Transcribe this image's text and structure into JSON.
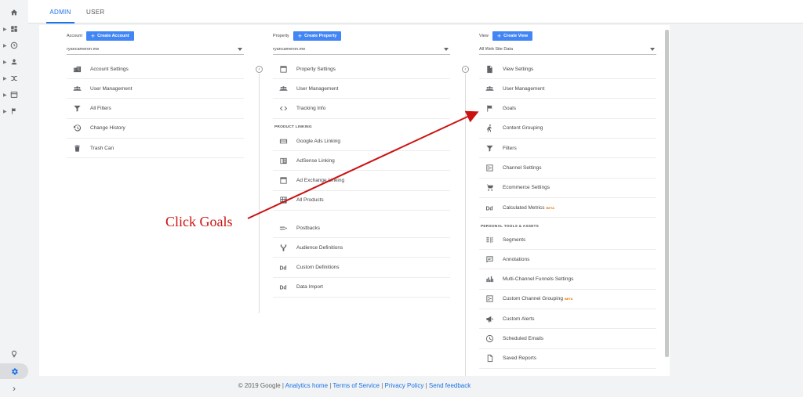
{
  "tabs": {
    "admin": "ADMIN",
    "user": "USER"
  },
  "account": {
    "label": "Account",
    "create_label": "Create Account",
    "selected": "ryancameron.me",
    "items": [
      {
        "label": "Account Settings",
        "icon": "building-icon"
      },
      {
        "label": "User Management",
        "icon": "people-icon"
      },
      {
        "label": "All Filters",
        "icon": "filter-icon"
      },
      {
        "label": "Change History",
        "icon": "history-icon"
      },
      {
        "label": "Trash Can",
        "icon": "trash-icon"
      }
    ]
  },
  "property": {
    "label": "Property",
    "create_label": "Create Property",
    "selected": "ryancameron.me",
    "items": [
      {
        "label": "Property Settings",
        "icon": "window-icon"
      },
      {
        "label": "User Management",
        "icon": "people-icon"
      },
      {
        "label": "Tracking Info",
        "icon": "code-icon"
      }
    ],
    "section_label": "PRODUCT LINKING",
    "linking_items": [
      {
        "label": "Google Ads Linking",
        "icon": "ads-icon"
      },
      {
        "label": "AdSense Linking",
        "icon": "book-icon"
      },
      {
        "label": "Ad Exchange Linking",
        "icon": "window-icon"
      },
      {
        "label": "All Products",
        "icon": "grid-icon"
      }
    ],
    "more_items": [
      {
        "label": "Postbacks",
        "icon": "postback-icon"
      },
      {
        "label": "Audience Definitions",
        "icon": "fork-icon"
      },
      {
        "label": "Custom Definitions",
        "icon": "dd-icon"
      },
      {
        "label": "Data Import",
        "icon": "dd-icon"
      }
    ]
  },
  "view": {
    "label": "View",
    "create_label": "Create View",
    "selected": "All Web Site Data",
    "items": [
      {
        "label": "View Settings",
        "icon": "document-icon",
        "beta": ""
      },
      {
        "label": "User Management",
        "icon": "people-icon",
        "beta": ""
      },
      {
        "label": "Goals",
        "icon": "flag-icon",
        "beta": ""
      },
      {
        "label": "Content Grouping",
        "icon": "walk-icon",
        "beta": ""
      },
      {
        "label": "Filters",
        "icon": "filter-icon",
        "beta": ""
      },
      {
        "label": "Channel Settings",
        "icon": "channel-icon",
        "beta": ""
      },
      {
        "label": "Ecommerce Settings",
        "icon": "cart-icon",
        "beta": ""
      },
      {
        "label": "Calculated Metrics",
        "icon": "dd-icon",
        "beta": "BETA"
      }
    ],
    "section_label": "PERSONAL TOOLS & ASSETS",
    "tool_items": [
      {
        "label": "Segments",
        "icon": "segments-icon",
        "beta": ""
      },
      {
        "label": "Annotations",
        "icon": "comment-icon",
        "beta": ""
      },
      {
        "label": "Multi-Channel Funnels Settings",
        "icon": "bars-icon",
        "beta": ""
      },
      {
        "label": "Custom Channel Grouping",
        "icon": "channel-icon",
        "beta": "BETA"
      },
      {
        "label": "Custom Alerts",
        "icon": "megaphone-icon",
        "beta": ""
      },
      {
        "label": "Scheduled Emails",
        "icon": "clock-icon",
        "beta": ""
      },
      {
        "label": "Saved Reports",
        "icon": "file-icon",
        "beta": ""
      }
    ]
  },
  "annotation": {
    "text": "Click Goals",
    "color": "#cc1111"
  },
  "footer": {
    "copyright": "© 2019 Google",
    "links": [
      "Analytics home",
      "Terms of Service",
      "Privacy Policy",
      "Send feedback"
    ]
  },
  "colors": {
    "accent": "#1a73e8",
    "button": "#4285f4",
    "beta": "#e37400"
  }
}
